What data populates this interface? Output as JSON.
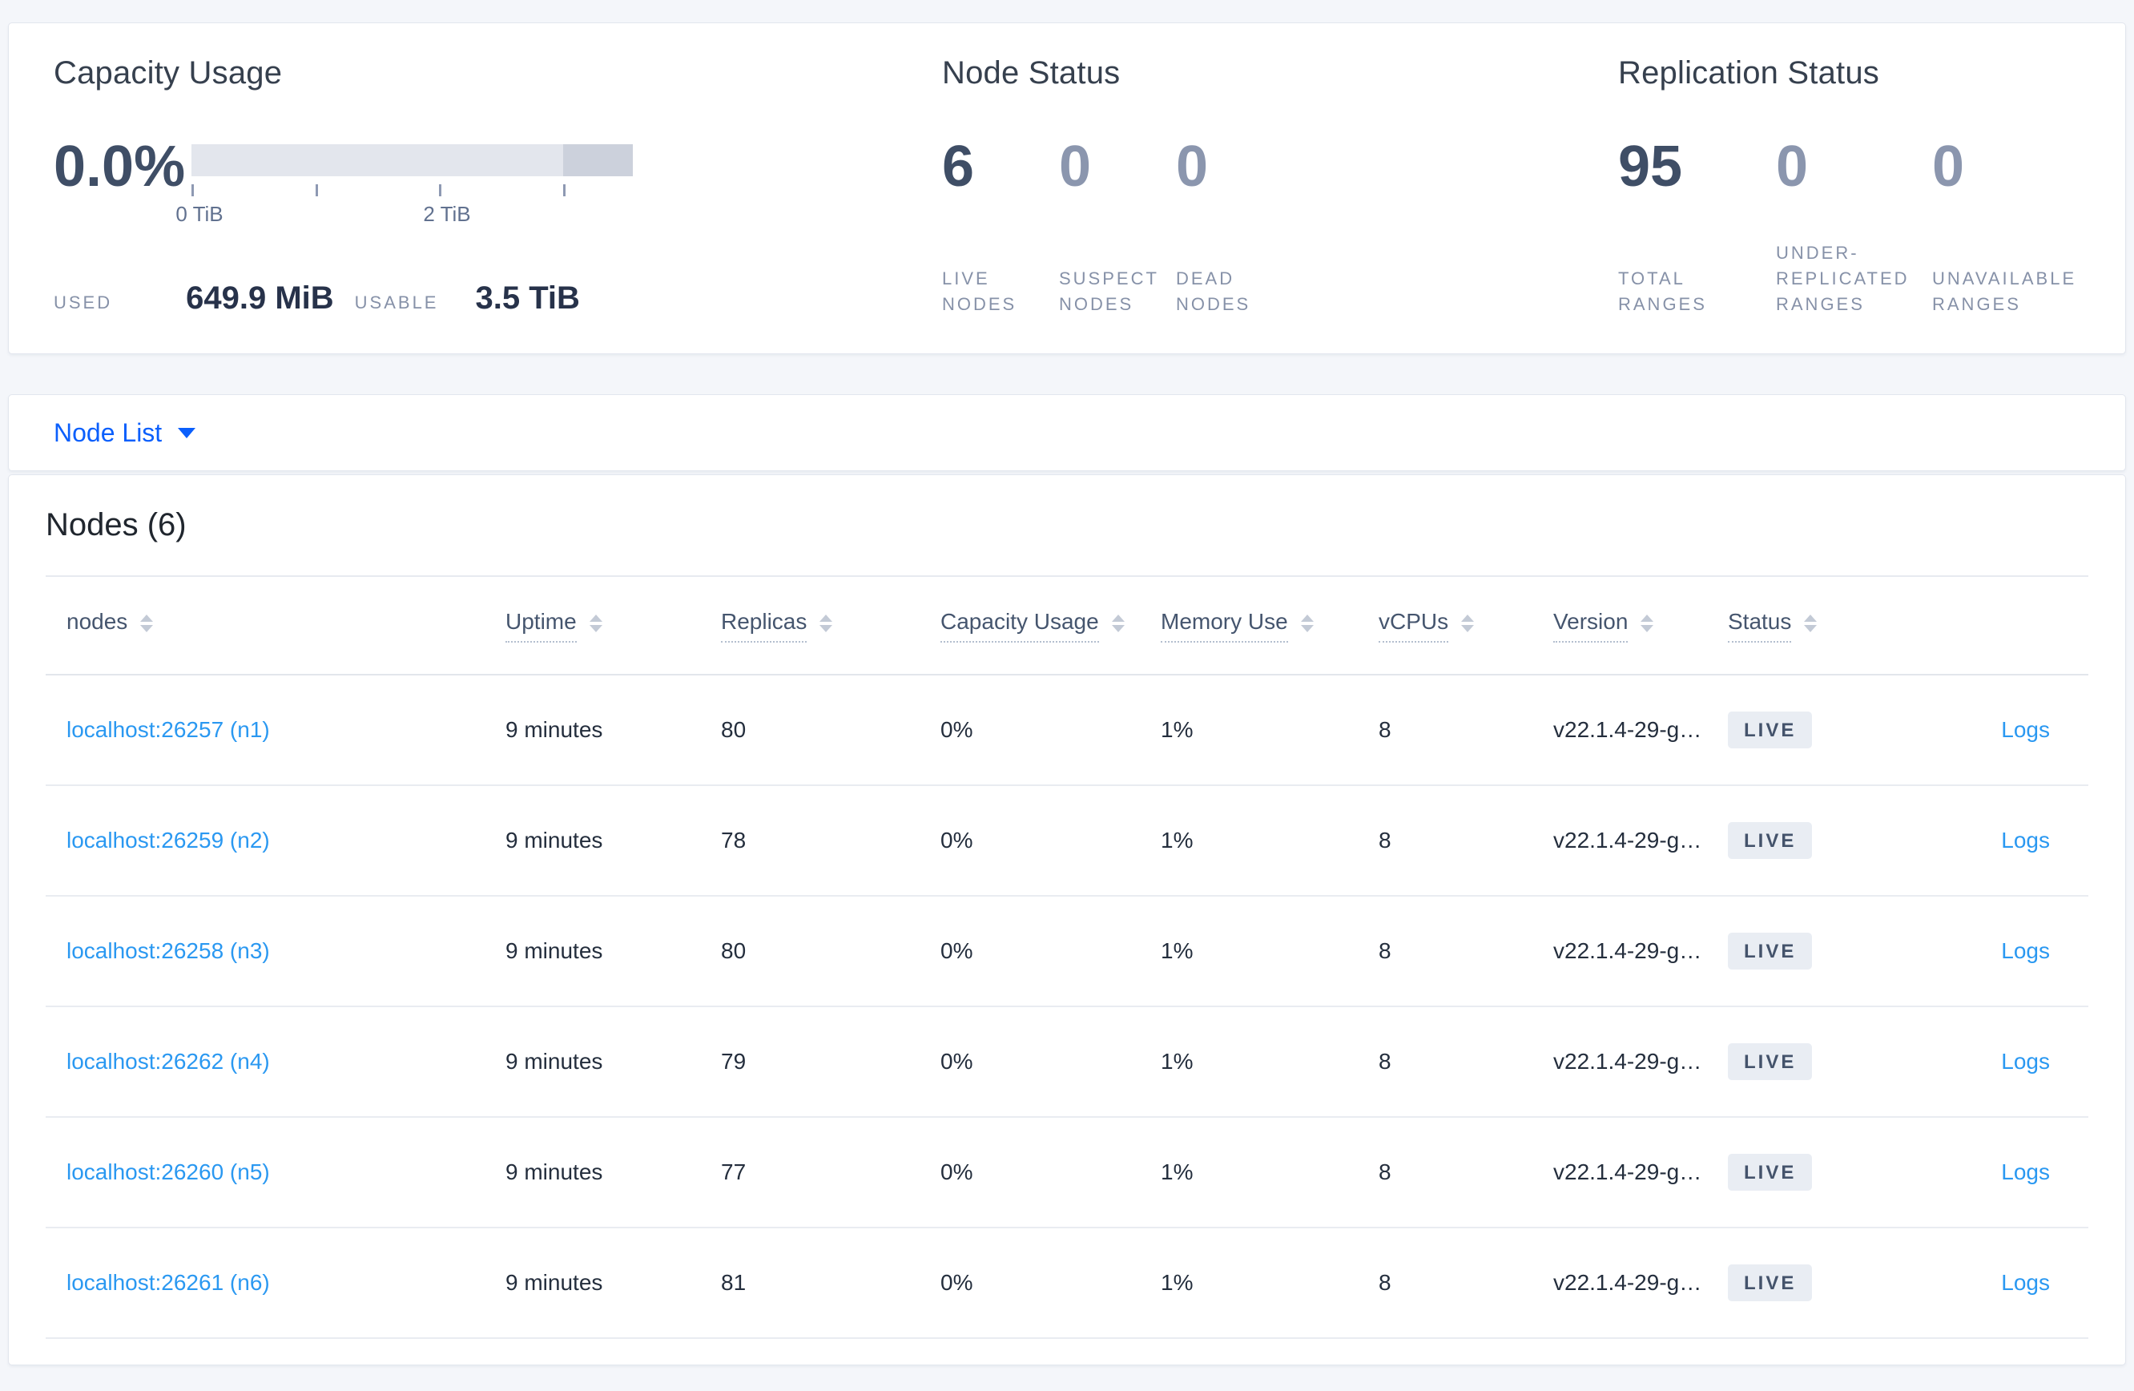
{
  "capacity": {
    "title": "Capacity Usage",
    "percent": "0.0%",
    "tick_labels": [
      "0 TiB",
      "2 TiB"
    ],
    "used_label": "USED",
    "used_value": "649.9 MiB",
    "usable_label": "USABLE",
    "usable_value": "3.5 TiB"
  },
  "node_status": {
    "title": "Node Status",
    "stats": [
      {
        "value": "6",
        "label": "LIVE NODES"
      },
      {
        "value": "0",
        "label": "SUSPECT NODES"
      },
      {
        "value": "0",
        "label": "DEAD NODES"
      }
    ]
  },
  "replication": {
    "title": "Replication Status",
    "stats": [
      {
        "value": "95",
        "label": "TOTAL RANGES"
      },
      {
        "value": "0",
        "label": "UNDER-REPLICATED RANGES"
      },
      {
        "value": "0",
        "label": "UNAVAILABLE RANGES"
      }
    ]
  },
  "view_selector": {
    "label": "Node List"
  },
  "table": {
    "title": "Nodes (6)",
    "columns": [
      "nodes",
      "Uptime",
      "Replicas",
      "Capacity Usage",
      "Memory Use",
      "vCPUs",
      "Version",
      "Status"
    ],
    "logs_label": "Logs",
    "rows": [
      {
        "node": "localhost:26257 (n1)",
        "uptime": "9 minutes",
        "replicas": "80",
        "capacity": "0%",
        "memory": "1%",
        "vcpus": "8",
        "version": "v22.1.4-29-g…",
        "status": "LIVE"
      },
      {
        "node": "localhost:26259 (n2)",
        "uptime": "9 minutes",
        "replicas": "78",
        "capacity": "0%",
        "memory": "1%",
        "vcpus": "8",
        "version": "v22.1.4-29-g…",
        "status": "LIVE"
      },
      {
        "node": "localhost:26258 (n3)",
        "uptime": "9 minutes",
        "replicas": "80",
        "capacity": "0%",
        "memory": "1%",
        "vcpus": "8",
        "version": "v22.1.4-29-g…",
        "status": "LIVE"
      },
      {
        "node": "localhost:26262 (n4)",
        "uptime": "9 minutes",
        "replicas": "79",
        "capacity": "0%",
        "memory": "1%",
        "vcpus": "8",
        "version": "v22.1.4-29-g…",
        "status": "LIVE"
      },
      {
        "node": "localhost:26260 (n5)",
        "uptime": "9 minutes",
        "replicas": "77",
        "capacity": "0%",
        "memory": "1%",
        "vcpus": "8",
        "version": "v22.1.4-29-g…",
        "status": "LIVE"
      },
      {
        "node": "localhost:26261 (n6)",
        "uptime": "9 minutes",
        "replicas": "81",
        "capacity": "0%",
        "memory": "1%",
        "vcpus": "8",
        "version": "v22.1.4-29-g…",
        "status": "LIVE"
      }
    ]
  },
  "colors": {
    "accent_blue": "#0b5ffc",
    "link_blue": "#2a98f1",
    "dark_number": "#3f4e66",
    "muted_number": "#8b96ae",
    "badge_bg": "#e9edf3",
    "bar_light": "#e3e6ed",
    "bar_dark": "#ccd1dc"
  }
}
